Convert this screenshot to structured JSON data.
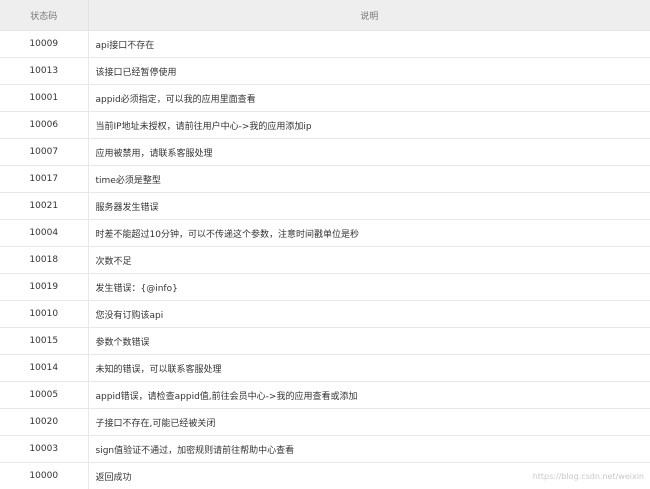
{
  "table": {
    "headers": [
      "状态码",
      "说明"
    ],
    "rows": [
      {
        "code": "10009",
        "desc": "api接口不存在"
      },
      {
        "code": "10013",
        "desc": "该接口已经暂停使用"
      },
      {
        "code": "10001",
        "desc": "appid必须指定，可以我的应用里面查看"
      },
      {
        "code": "10006",
        "desc": "当前IP地址未授权，请前往用户中心->我的应用添加ip"
      },
      {
        "code": "10007",
        "desc": "应用被禁用，请联系客服处理"
      },
      {
        "code": "10017",
        "desc": "time必须是整型"
      },
      {
        "code": "10021",
        "desc": "服务器发生错误"
      },
      {
        "code": "10004",
        "desc": "时差不能超过10分钟，可以不传递这个参数，注意时间戳单位是秒"
      },
      {
        "code": "10018",
        "desc": "次数不足"
      },
      {
        "code": "10019",
        "desc": "发生错误：{@info}"
      },
      {
        "code": "10010",
        "desc": "您没有订购该api"
      },
      {
        "code": "10015",
        "desc": "参数个数错误"
      },
      {
        "code": "10014",
        "desc": "未知的错误，可以联系客服处理"
      },
      {
        "code": "10005",
        "desc": "appid错误，请检查appid值,前往会员中心->我的应用查看或添加"
      },
      {
        "code": "10020",
        "desc": "子接口不存在,可能已经被关闭"
      },
      {
        "code": "10003",
        "desc": "sign值验证不通过，加密规则请前往帮助中心查看"
      },
      {
        "code": "10000",
        "desc": "返回成功"
      }
    ]
  },
  "watermark": "https://blog.csdn.net/weixin"
}
